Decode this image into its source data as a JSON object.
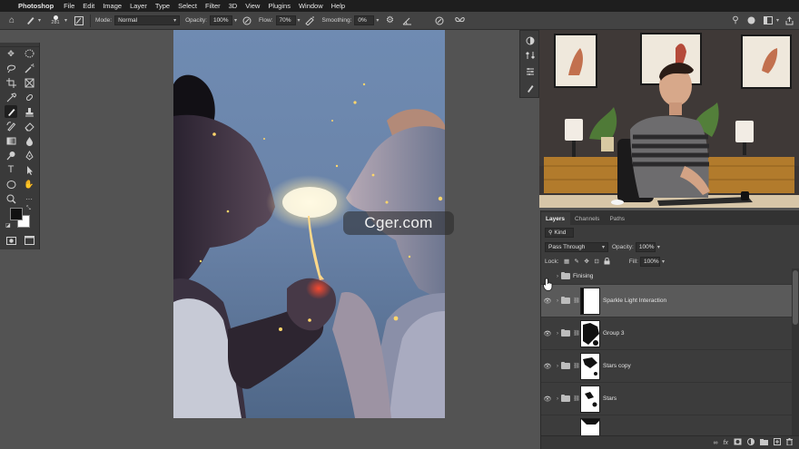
{
  "menubar": {
    "app_name": "Photoshop",
    "items": [
      "File",
      "Edit",
      "Image",
      "Layer",
      "Type",
      "Select",
      "Filter",
      "3D",
      "View",
      "Plugins",
      "Window",
      "Help"
    ]
  },
  "options": {
    "brush_size": "281",
    "mode_label": "Mode:",
    "mode_value": "Normal",
    "opacity_label": "Opacity:",
    "opacity_value": "100%",
    "flow_label": "Flow:",
    "flow_value": "70%",
    "smoothing_label": "Smoothing:",
    "smoothing_value": "0%"
  },
  "watermark": {
    "text": "Cger.com"
  },
  "layers_panel": {
    "tabs": [
      "Layers",
      "Channels",
      "Paths"
    ],
    "active_tab": "Layers",
    "kind_filter": "Kind",
    "blend_mode": "Pass Through",
    "opacity_label": "Opacity:",
    "opacity_value": "100%",
    "lock_label": "Lock:",
    "fill_label": "Fill:",
    "fill_value": "100%",
    "layers": [
      {
        "name": "Finising",
        "type": "group",
        "visible": false,
        "selected": false
      },
      {
        "name": "Sparkle Light Interaction",
        "type": "group",
        "visible": true,
        "selected": true
      },
      {
        "name": "Group 3",
        "type": "group",
        "visible": true,
        "selected": false
      },
      {
        "name": "Stars copy",
        "type": "group",
        "visible": true,
        "selected": false
      },
      {
        "name": "Stars",
        "type": "group",
        "visible": true,
        "selected": false
      }
    ]
  },
  "colors": {
    "foreground": "#111111",
    "background": "#ffffff",
    "selected_layer": "#5a5a5a"
  }
}
